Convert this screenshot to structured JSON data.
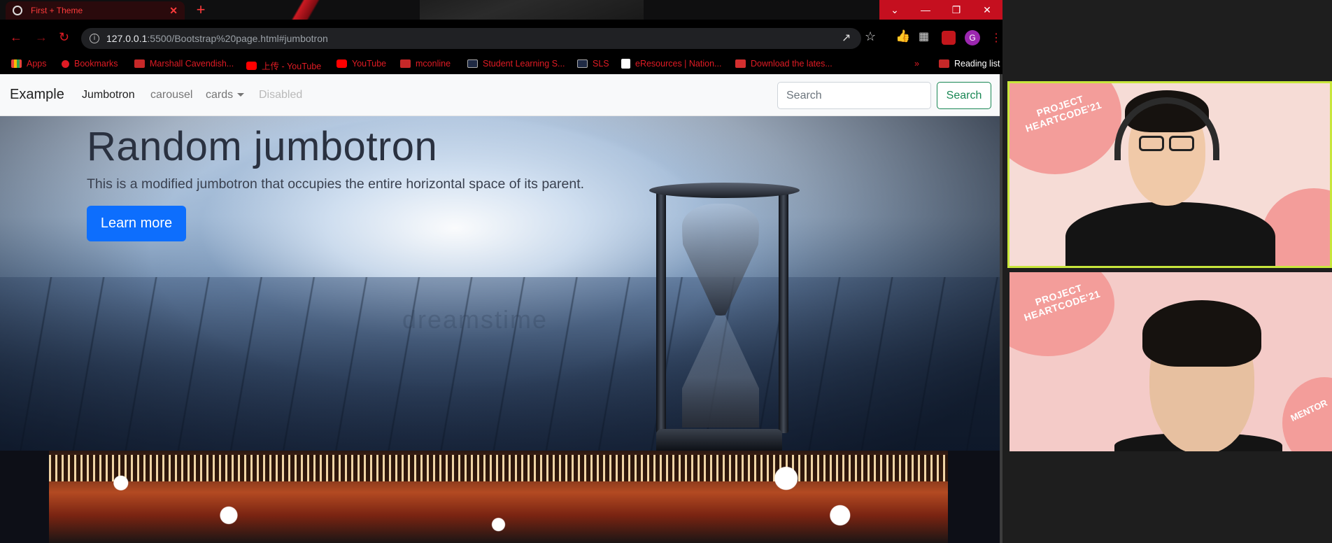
{
  "browser": {
    "tab_title": "First + Theme",
    "tab_close": "✕",
    "new_tab": "+",
    "url_host": "127.0.0.1",
    "url_path": ":5500/Bootstrap%20page.html#jumbotron",
    "profile_initial": "G"
  },
  "bookmarks": [
    {
      "label": "Apps",
      "icon": "apps-grid-icon"
    },
    {
      "label": "Bookmarks",
      "icon": "bookmark-star-icon"
    },
    {
      "label": "Marshall Cavendish...",
      "icon": "mc-logo-icon"
    },
    {
      "label": "上传 - YouTube",
      "icon": "youtube-icon"
    },
    {
      "label": "YouTube",
      "icon": "youtube-icon"
    },
    {
      "label": "mconline",
      "icon": "mc-logo-icon"
    },
    {
      "label": "Student Learning S...",
      "icon": "sls-icon"
    },
    {
      "label": "SLS",
      "icon": "sls-icon"
    },
    {
      "label": "eResources | Nation...",
      "icon": "nlb-icon"
    },
    {
      "label": "Download the lates...",
      "icon": "download-icon"
    },
    {
      "label": "»",
      "icon": "overflow-chevron-icon"
    },
    {
      "label": "Reading list",
      "icon": "reading-list-icon"
    }
  ],
  "navbar": {
    "brand": "Example",
    "links": [
      "Jumbotron",
      "carousel",
      "cards",
      "Disabled"
    ],
    "search_placeholder": "Search",
    "search_button": "Search"
  },
  "jumbotron": {
    "title": "Random jumbotron",
    "lead": "This is a modified jumbotron that occupies the entire horizontal space of its parent.",
    "button": "Learn more",
    "watermark": "dreamstime"
  },
  "video_tiles": [
    {
      "lines": [
        "PROJECT",
        "HEARTCODE'21"
      ]
    },
    {
      "lines": [
        "PROJECT",
        "HEARTCODE'21"
      ],
      "badge": "MENTOR"
    }
  ],
  "colors": {
    "accent_red": "#e01b24",
    "bootstrap_primary": "#0d6efd",
    "bootstrap_success": "#198754",
    "active_speaker": "#c8e63c"
  }
}
